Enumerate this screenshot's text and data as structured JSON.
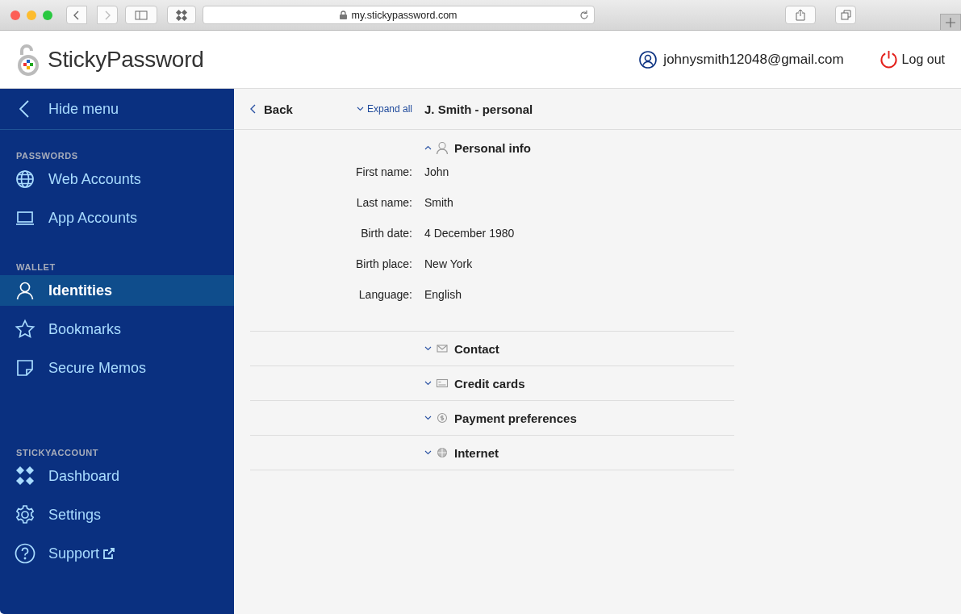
{
  "browser": {
    "url": "my.stickypassword.com"
  },
  "header": {
    "logo": "**Sticky**Password",
    "account": "johnysmith12048@gmail.com",
    "logout": "Log out"
  },
  "sidebar": {
    "hide_menu": "Hide menu",
    "sections": [
      {
        "title": "PASSWORDS",
        "items": [
          {
            "label": "Web Accounts",
            "selected": false
          },
          {
            "label": "App Accounts",
            "selected": false
          }
        ]
      },
      {
        "title": "WALLET",
        "items": [
          {
            "label": "Identities",
            "selected": true
          },
          {
            "label": "Bookmarks",
            "selected": false
          },
          {
            "label": "Secure Memos",
            "selected": false
          }
        ]
      },
      {
        "title": "STICKYACCOUNT",
        "items": [
          {
            "label": "Dashboard",
            "selected": false
          },
          {
            "label": "Settings",
            "selected": false
          },
          {
            "label": "Support",
            "selected": false,
            "external": true
          }
        ]
      }
    ]
  },
  "toolbar": {
    "back": "Back",
    "expand_all": "Expand all",
    "title": "J. Smith - personal"
  },
  "sections": [
    {
      "title": "Personal info",
      "expanded": true,
      "fields": [
        {
          "label": "First name:",
          "value": "John"
        },
        {
          "label": "Last name:",
          "value": "Smith"
        },
        {
          "label": "Birth date:",
          "value": "4 December 1980"
        },
        {
          "label": "Birth place:",
          "value": "New York"
        },
        {
          "label": "Language:",
          "value": "English"
        }
      ]
    },
    {
      "title": "Contact",
      "expanded": false
    },
    {
      "title": "Credit cards",
      "expanded": false
    },
    {
      "title": "Payment preferences",
      "expanded": false
    },
    {
      "title": "Internet",
      "expanded": false
    }
  ]
}
